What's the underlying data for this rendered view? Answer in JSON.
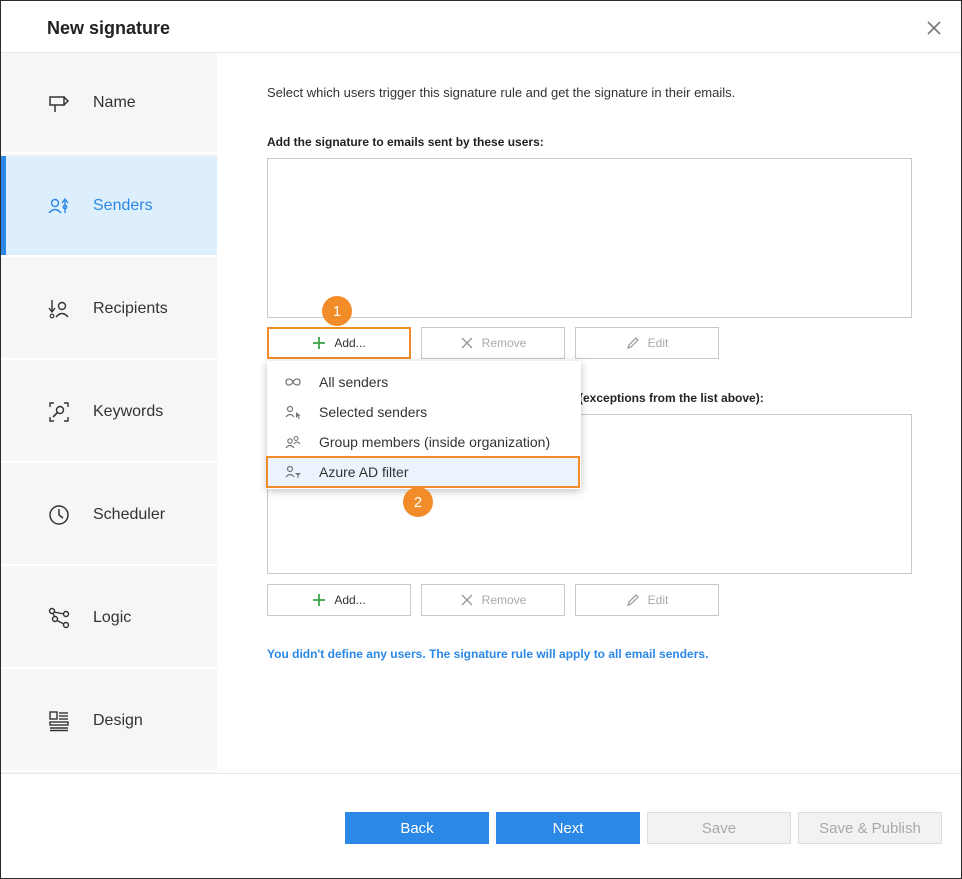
{
  "dialog": {
    "title": "New signature"
  },
  "sidebar": {
    "items": [
      {
        "label": "Name",
        "icon": "signpost-icon",
        "active": false
      },
      {
        "label": "Senders",
        "icon": "senders-icon",
        "active": true
      },
      {
        "label": "Recipients",
        "icon": "recipients-icon",
        "active": false
      },
      {
        "label": "Keywords",
        "icon": "keywords-icon",
        "active": false
      },
      {
        "label": "Scheduler",
        "icon": "clock-icon",
        "active": false
      },
      {
        "label": "Logic",
        "icon": "logic-icon",
        "active": false
      },
      {
        "label": "Design",
        "icon": "design-icon",
        "active": false
      }
    ]
  },
  "main": {
    "intro": "Select which users trigger this signature rule and get the signature in their emails.",
    "senders_section": {
      "label": "Add the signature to emails sent by these users:"
    },
    "exceptions_section": {
      "label_visible": "(exceptions from the list above):"
    },
    "buttons": {
      "add": "Add...",
      "remove": "Remove",
      "edit": "Edit"
    },
    "dropdown": {
      "items": [
        {
          "label": "All senders",
          "icon": "infinity-icon"
        },
        {
          "label": "Selected senders",
          "icon": "user-pointer-icon"
        },
        {
          "label": "Group members (inside organization)",
          "icon": "group-icon"
        },
        {
          "label": "Azure AD filter",
          "icon": "user-filter-icon",
          "highlighted": true
        }
      ]
    },
    "callouts": [
      "1",
      "2"
    ],
    "hint": "You didn't define any users. The signature rule will apply to all email senders."
  },
  "footer": {
    "back": "Back",
    "next": "Next",
    "save": "Save",
    "save_publish": "Save & Publish"
  },
  "colors": {
    "accent": "#2b88e6",
    "highlight": "#f28c28",
    "active_bg": "#ddeefc"
  }
}
